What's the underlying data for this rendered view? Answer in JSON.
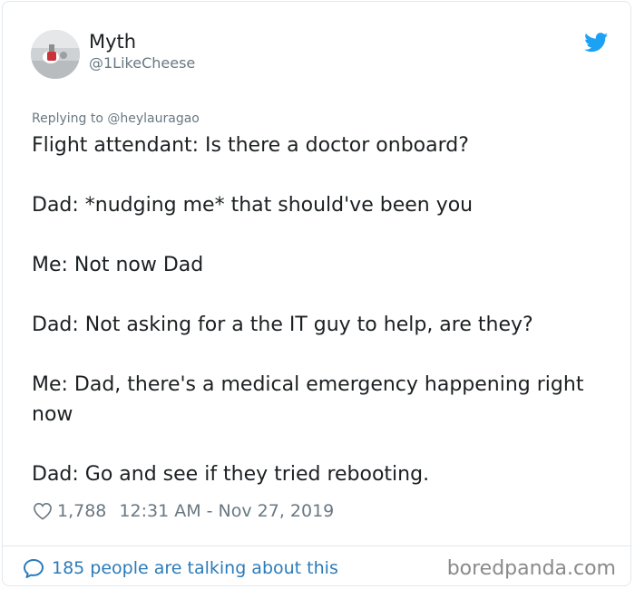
{
  "author": {
    "name": "Myth",
    "handle": "@1LikeCheese"
  },
  "tweet": {
    "replying_to": "Replying to @heylauragao",
    "paragraphs": [
      "Flight attendant: Is there a doctor onboard?",
      "Dad: *nudging me* that should've been you",
      "Me: Not now Dad",
      "Dad: Not asking for a the IT guy to help, are they?",
      "Me: Dad, there's a medical emergency happening right now",
      "Dad: Go and see if they tried rebooting."
    ],
    "likes": "1,788",
    "timestamp": "12:31 AM - Nov 27, 2019"
  },
  "footer": {
    "talking_text": "185 people are talking about this"
  },
  "watermark": "boredpanda.com",
  "icons": {
    "brand": "twitter-bird-icon",
    "like": "heart-icon",
    "reply": "speech-bubble-icon"
  },
  "colors": {
    "twitter_blue": "#1da1f2",
    "link_blue": "#2b7bb9",
    "text": "#1c2022",
    "muted": "#697882"
  }
}
